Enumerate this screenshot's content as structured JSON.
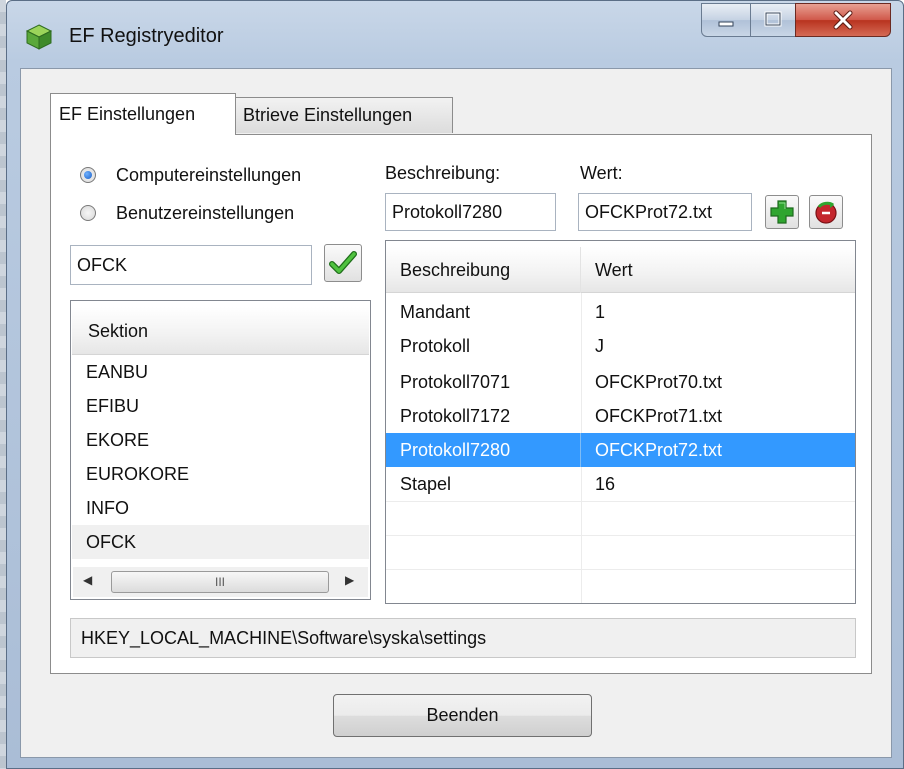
{
  "window": {
    "title": "EF Registryeditor",
    "controls": {
      "minimize": "–",
      "maximize": "□",
      "close": "X"
    }
  },
  "tabs": [
    {
      "label": "EF Einstellungen",
      "active": true
    },
    {
      "label": "Btrieve Einstellungen",
      "active": false
    }
  ],
  "scope": {
    "options": [
      {
        "label": "Computereinstellungen",
        "checked": true
      },
      {
        "label": "Benutzereinstellungen",
        "checked": false
      }
    ]
  },
  "entry": {
    "desc_label": "Beschreibung:",
    "value_label": "Wert:",
    "desc_value": "Protokoll7280",
    "value_value": "OFCKProt72.txt"
  },
  "section_filter": {
    "value": "OFCK"
  },
  "section_list": {
    "header": "Sektion",
    "items": [
      "EANBU",
      "EFIBU",
      "EKORE",
      "EUROKORE",
      "INFO",
      "OFCK"
    ],
    "selected": "OFCK",
    "scroll_thumb": "III"
  },
  "grid": {
    "columns": [
      "Beschreibung",
      "Wert"
    ],
    "rows": [
      [
        "Mandant",
        "1"
      ],
      [
        "Protokoll",
        "J"
      ],
      [
        "Protokoll7071",
        "OFCKProt70.txt"
      ],
      [
        "Protokoll7172",
        "OFCKProt71.txt"
      ],
      [
        "Protokoll7280",
        "OFCKProt72.txt"
      ],
      [
        "Stapel",
        "16"
      ]
    ],
    "selected_row": 4
  },
  "registry_path": "HKEY_LOCAL_MACHINE\\Software\\syska\\settings",
  "buttons": {
    "end": "Beenden"
  },
  "icons": {
    "app": "app-cube-icon",
    "confirm": "checkmark-icon",
    "add": "plus-icon",
    "delete": "delete-icon"
  },
  "colors": {
    "selection": "#3399ff",
    "checkmark": "#3a9c2a",
    "add": "#2fa52f",
    "delete": "#c4262d"
  }
}
